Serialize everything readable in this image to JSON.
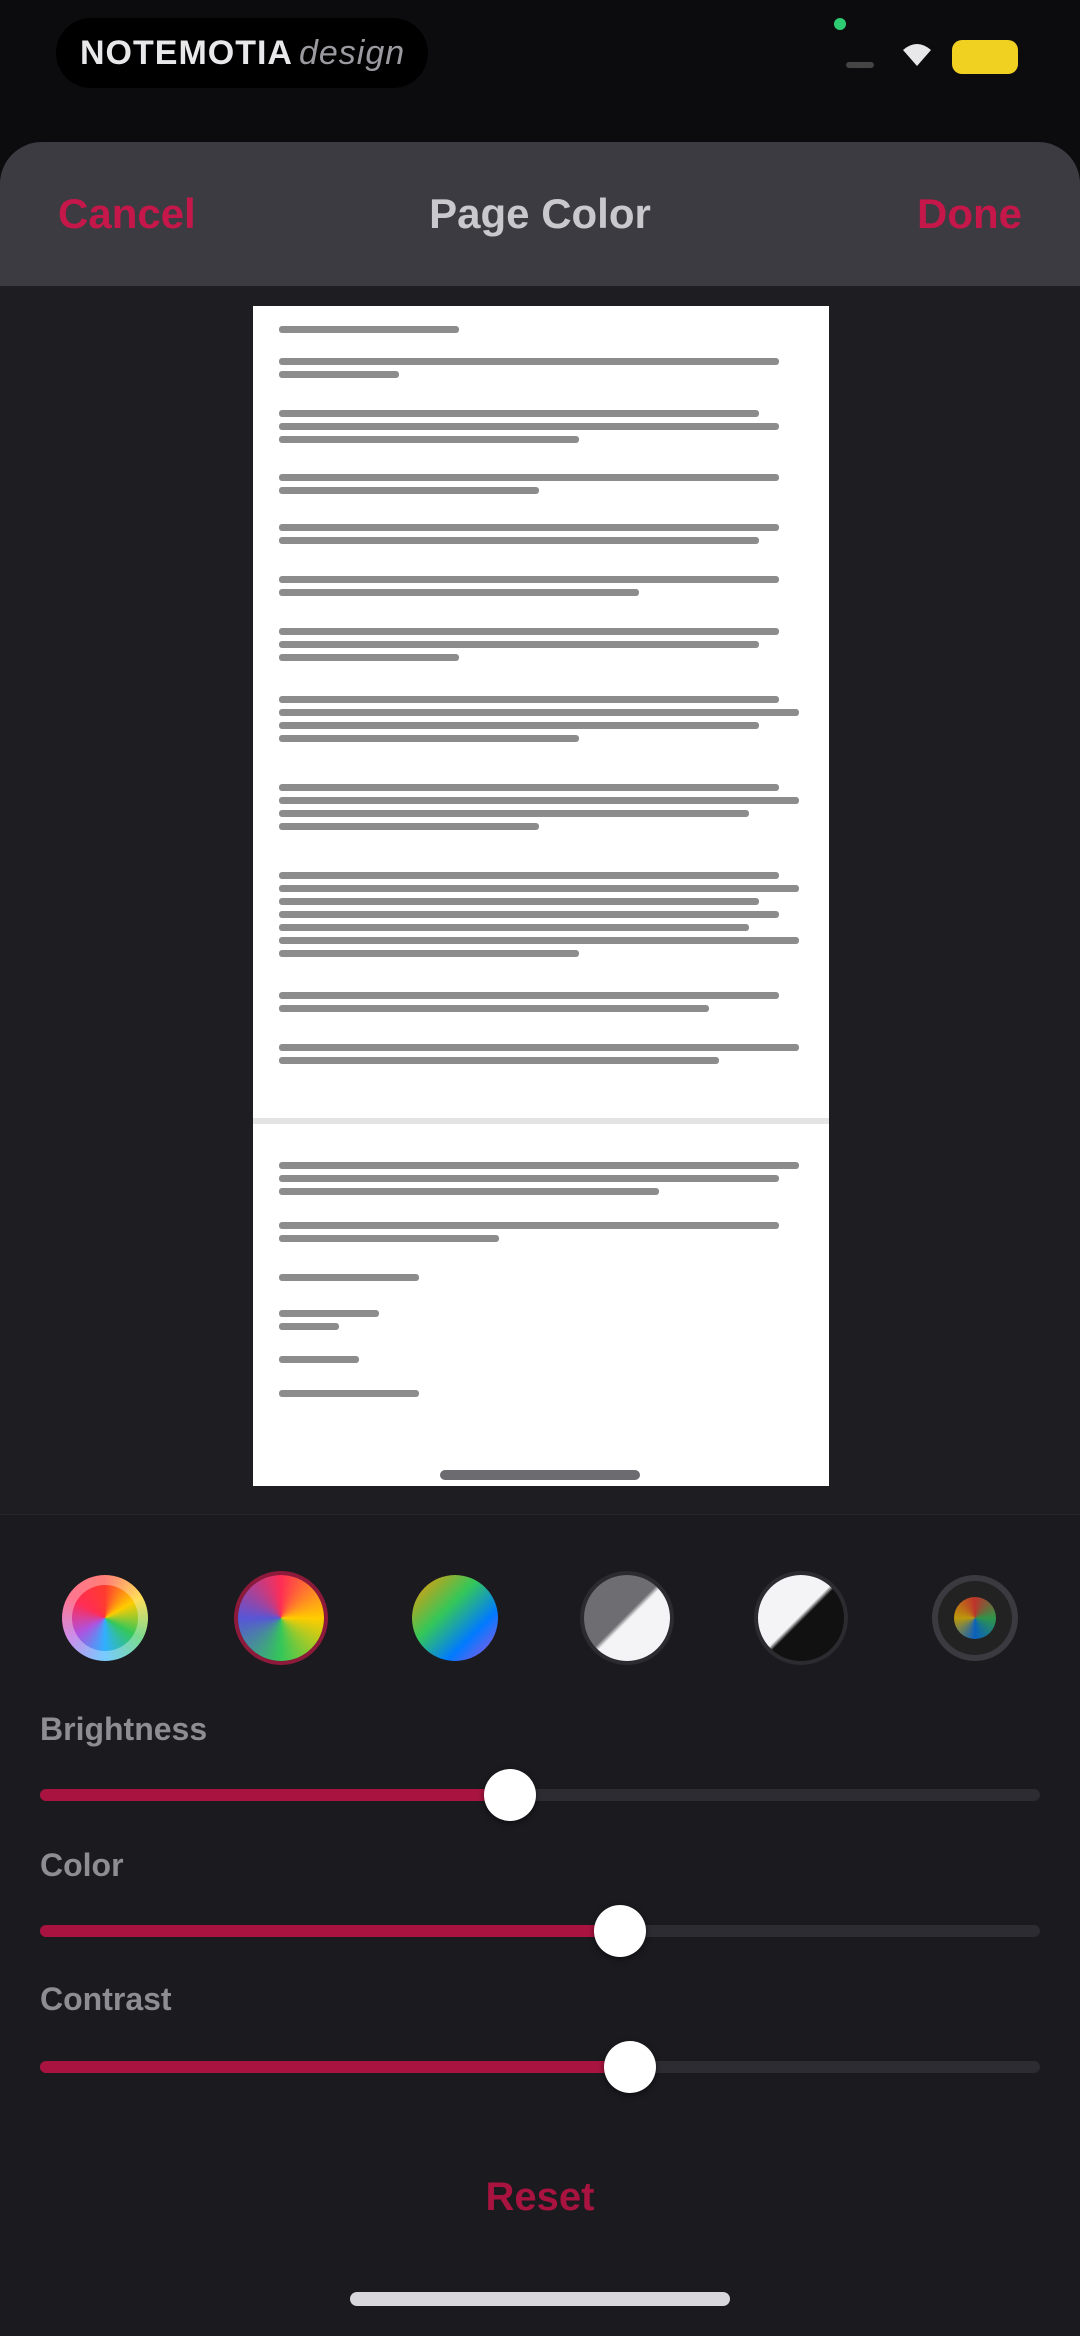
{
  "status_bar": {
    "app_label": "NOTEMOTIA",
    "app_label_suffix": "design"
  },
  "nav": {
    "cancel_label": "Cancel",
    "title": "Page Color",
    "done_label": "Done"
  },
  "presets": [
    {
      "name": "color-wheel-preset"
    },
    {
      "name": "vivid-color-preset"
    },
    {
      "name": "rainbow-preset"
    },
    {
      "name": "gray-white-preset"
    },
    {
      "name": "black-white-preset"
    },
    {
      "name": "dark-color-preset"
    }
  ],
  "sliders": [
    {
      "label": "Brightness",
      "value_fraction": 0.47
    },
    {
      "label": "Color",
      "value_fraction": 0.58
    },
    {
      "label": "Contrast",
      "value_fraction": 0.59
    }
  ],
  "reset_label": "Reset",
  "colors": {
    "accent": "#c6174a",
    "slider_fill": "#a8143f",
    "sheet_bg": "#1e1d22",
    "nav_bg": "#3c3b41"
  }
}
